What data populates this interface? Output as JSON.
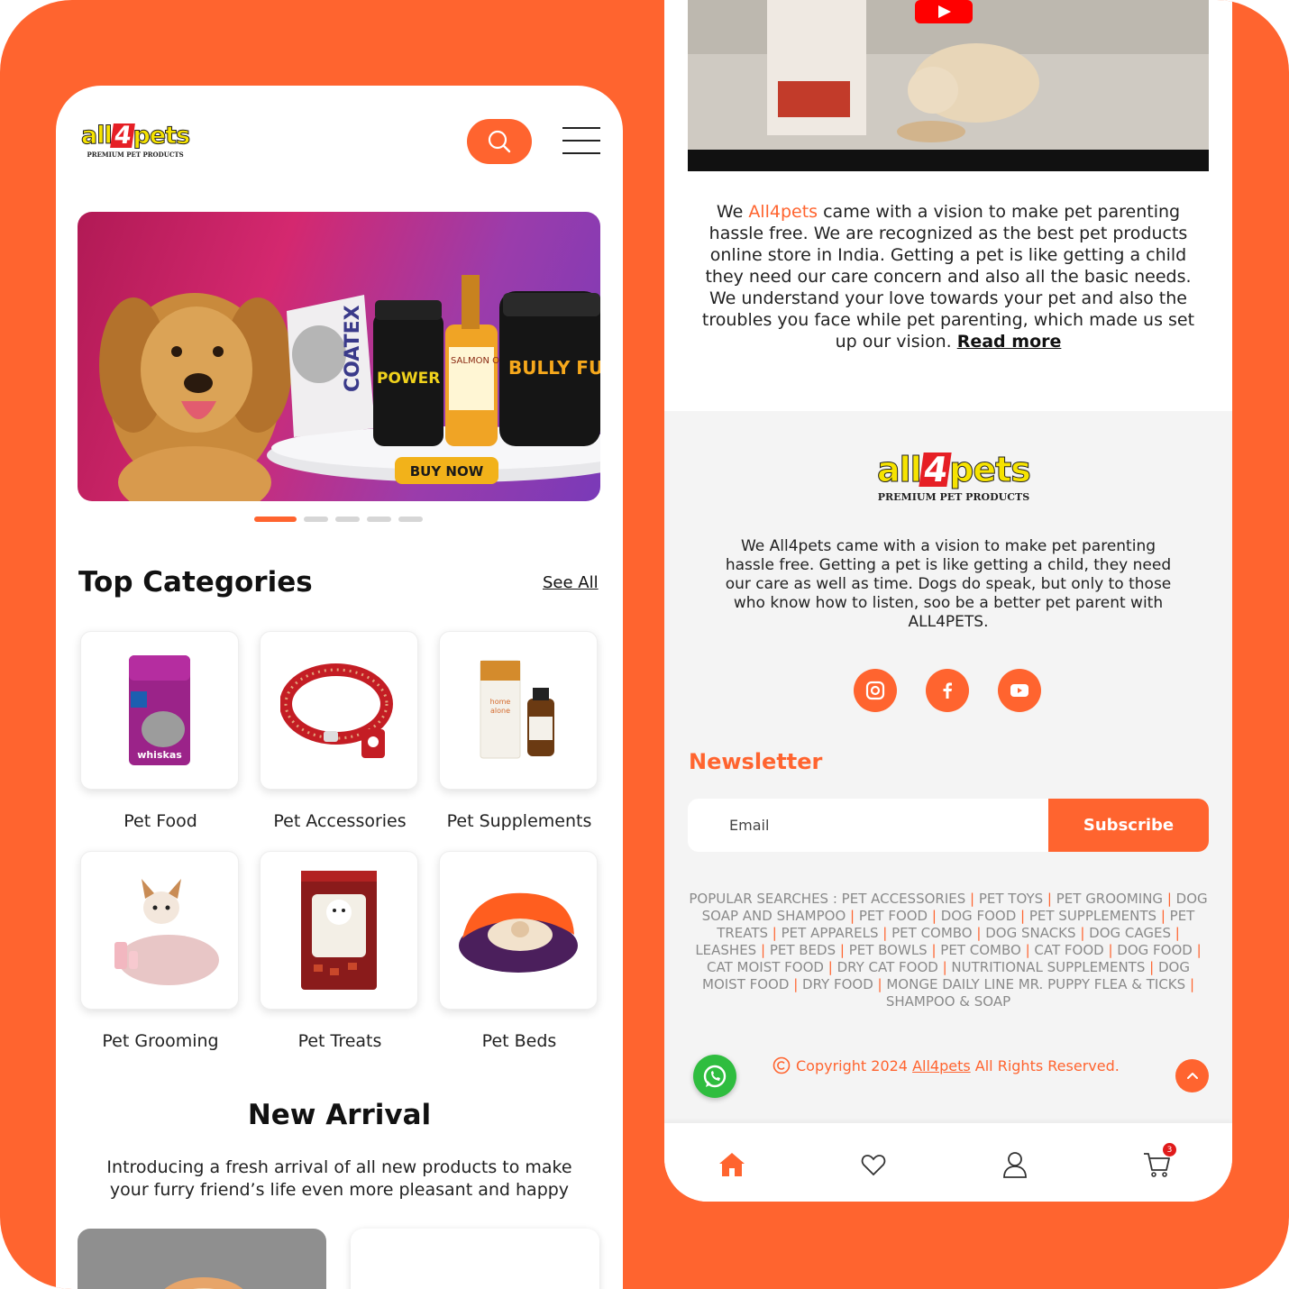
{
  "brand": {
    "logo_word_left": "all",
    "logo_word_four": "4",
    "logo_word_right": "pets",
    "tagline": "PREMIUM PET PRODUCTS",
    "accent_color": "#FF642F"
  },
  "header": {
    "search_icon": "search-icon",
    "menu_icon": "hamburger-menu-icon"
  },
  "banner": {
    "product_labels": [
      "COATEX",
      "POWER GAIN",
      "SALMON OIL",
      "BULLY FUEL"
    ],
    "cta": "BUY NOW",
    "slides_total": 5,
    "active_slide": 1
  },
  "top_categories": {
    "title": "Top Categories",
    "see_all": "See All",
    "items": [
      {
        "label": "Pet Food"
      },
      {
        "label": "Pet Accessories"
      },
      {
        "label": "Pet Supplements"
      },
      {
        "label": "Pet Grooming"
      },
      {
        "label": "Pet Treats"
      },
      {
        "label": "Pet Beds"
      }
    ]
  },
  "new_arrival": {
    "title": "New Arrival",
    "description": "Introducing a fresh arrival of all new products to make your furry friend’s life even more pleasant and happy"
  },
  "about": {
    "text_before": "We ",
    "highlight": "All4pets",
    "text_after": " came with a vision to make pet parenting hassle free. We are recognized as the best pet products online store in India. Getting a pet is like getting a child they need our care concern and also all the basic needs. We understand your love towards your pet and also the troubles you face while pet parenting, which made us set up our vision. ",
    "read_more": "Read more"
  },
  "footer": {
    "text": "We All4pets came with a vision to make pet parenting hassle free. Getting a pet is like getting a child, they need our care as well as time. Dogs do speak, but only to those who know how to listen, soo be a better pet parent with ALL4PETS.",
    "socials": [
      "instagram-icon",
      "facebook-icon",
      "youtube-icon"
    ],
    "newsletter_title": "Newsletter",
    "email_placeholder": "Email",
    "subscribe_label": "Subscribe",
    "popular_prefix": "POPULAR SEARCHES : ",
    "popular_items": [
      "PET ACCESSORIES",
      "PET TOYS",
      "PET GROOMING",
      "DOG SOAP AND SHAMPOO",
      "PET FOOD",
      "DOG FOOD",
      "PET SUPPLEMENTS",
      "PET TREATS",
      "PET APPARELS",
      "PET COMBO",
      "DOG SNACKS",
      "DOG CAGES",
      "LEASHES",
      "PET BEDS",
      "PET BOWLS",
      "PET COMBO",
      "CAT FOOD",
      "DOG FOOD",
      "CAT MOIST FOOD",
      "DRY CAT FOOD",
      "NUTRITIONAL SUPPLEMENTS",
      "DOG MOIST FOOD",
      "DRY FOOD",
      "MONGE DAILY LINE MR. PUPPY FLEA & TICKS",
      "SHAMPOO & SOAP"
    ],
    "copyright_before": "Copyright 2024 ",
    "copyright_brand": "All4pets",
    "copyright_after": " All Rights Reserved."
  },
  "bottom_nav": {
    "items": [
      "home-icon",
      "heart-icon",
      "user-icon",
      "cart-icon"
    ],
    "cart_count": "3"
  }
}
